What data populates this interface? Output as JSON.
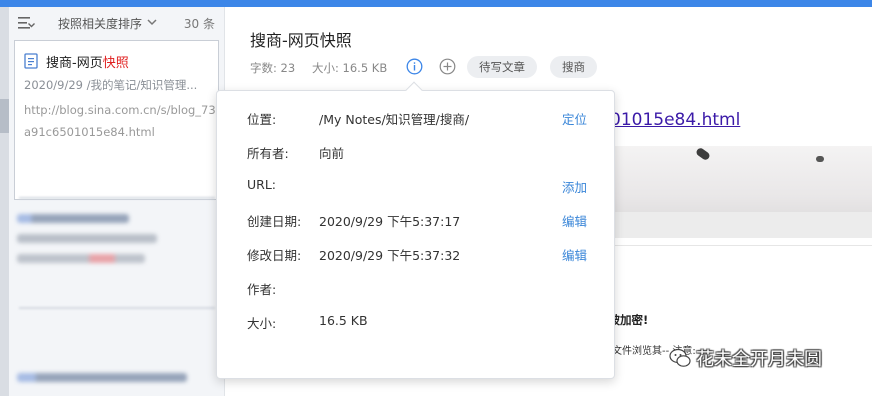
{
  "note_list": {
    "sort_label": "按照相关度排序",
    "count": "30 条",
    "active_note": {
      "title_prefix": "搜商-网页",
      "title_highlight": "快照",
      "meta": "2020/9/29  /我的笔记/知识管理...",
      "snippet": "http://blog.sina.com.cn/s/blog_73a91c6501015e84.html"
    }
  },
  "editor": {
    "title": "搜商-网页快照",
    "word_count": "字数: 23",
    "size": "大小:  16.5 KB",
    "tags": [
      "待写文章",
      "搜商"
    ],
    "link_fragment": "01015e84.html",
    "body_text_1": "经被加密!",
    "body_text_2": "文件浏览其-- 注意:",
    "watermark": "花未全开月未圆"
  },
  "info_popover": {
    "rows": [
      {
        "label": "位置:",
        "value": "/My Notes/知识管理/搜商/",
        "action": "定位"
      },
      {
        "label": "所有者:",
        "value": "向前",
        "action": ""
      },
      {
        "label": "URL:",
        "value": "",
        "action": "添加"
      },
      {
        "label": "创建日期:",
        "value": "2020/9/29 下午5:37:17",
        "action": "编辑"
      },
      {
        "label": "修改日期:",
        "value": "2020/9/29 下午5:37:32",
        "action": "编辑"
      },
      {
        "label": "作者:",
        "value": "",
        "action": ""
      },
      {
        "label": "大小:",
        "value": "16.5 KB",
        "action": ""
      }
    ]
  },
  "colors": {
    "accent": "#3c86e8",
    "link_action": "#3a86d8",
    "title_highlight": "#e02020"
  }
}
